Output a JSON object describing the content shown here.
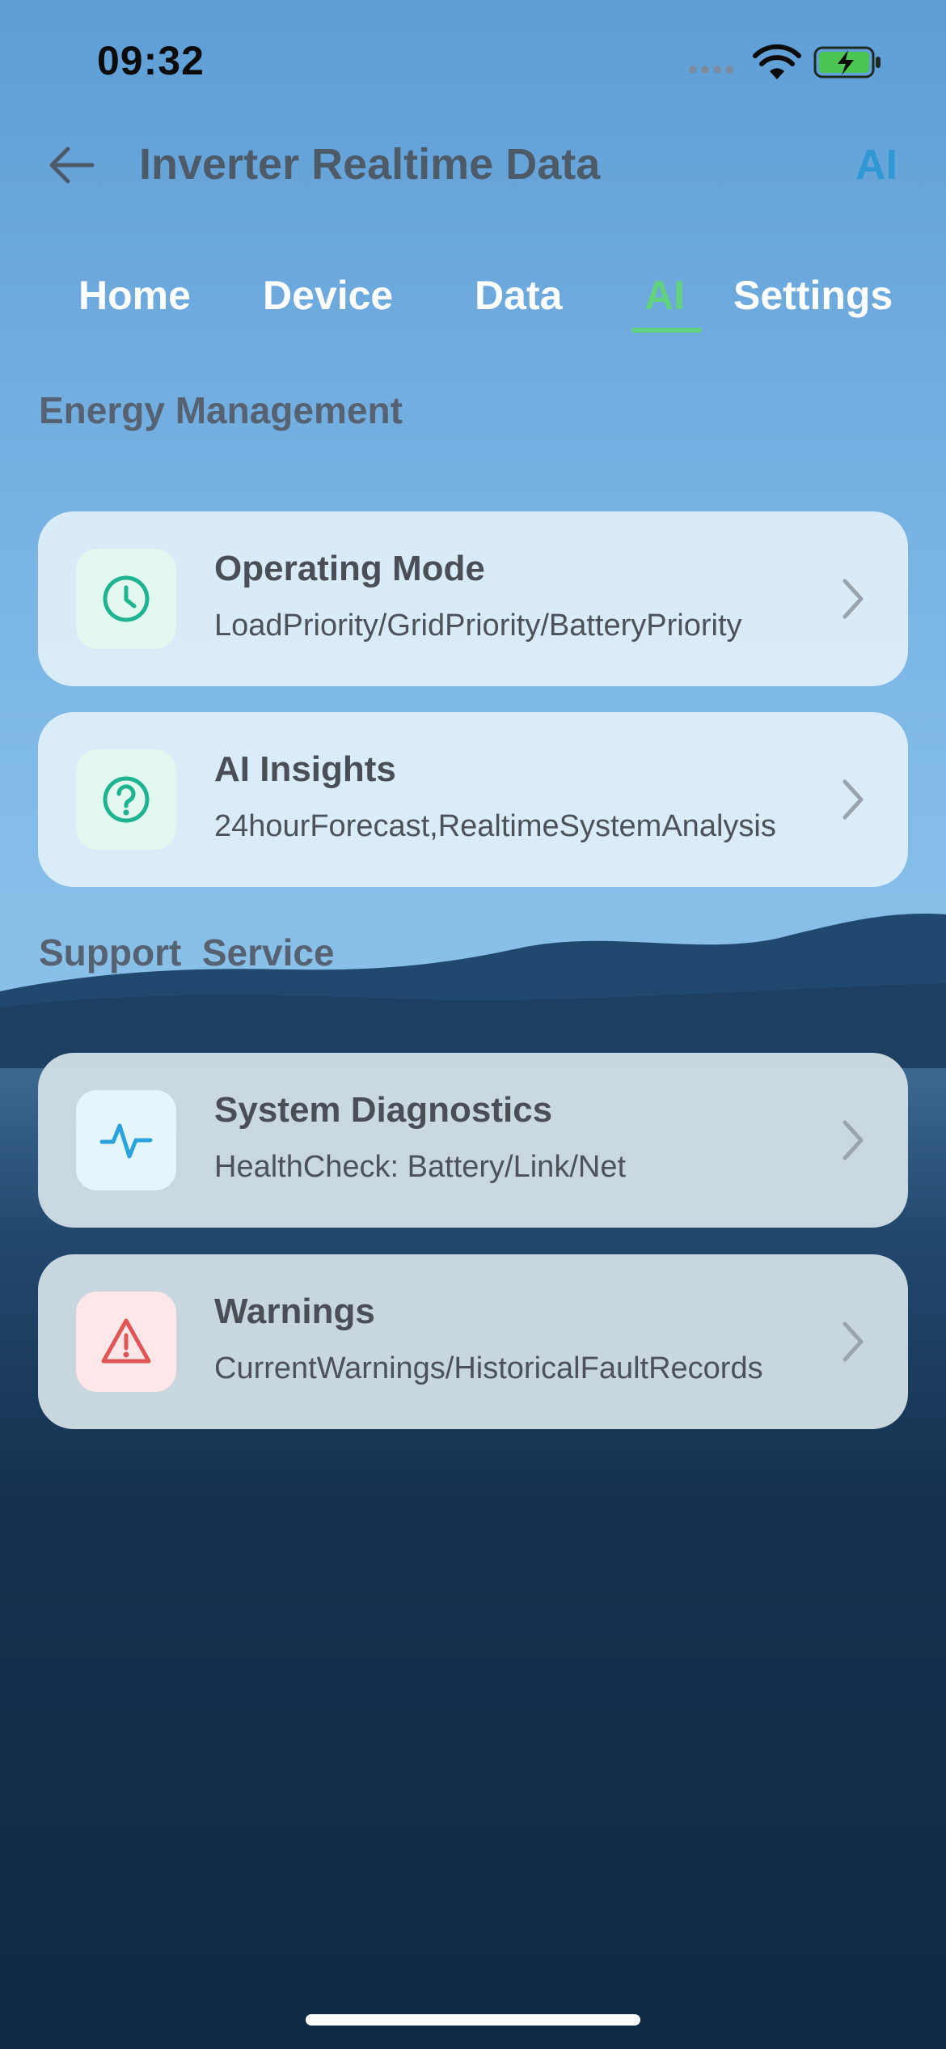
{
  "status_bar": {
    "time": "09:32"
  },
  "header": {
    "title": "Inverter Realtime Data",
    "right_label": "AI"
  },
  "tabs": [
    {
      "label": "Home",
      "active": false
    },
    {
      "label": "Device",
      "active": false
    },
    {
      "label": "Data",
      "active": false
    },
    {
      "label": "AI",
      "active": true
    },
    {
      "label": "Settings",
      "active": false
    }
  ],
  "sections": {
    "energy": {
      "title": "Energy Management",
      "items": [
        {
          "title": "Operating Mode",
          "subtitle": "LoadPriority/GridPriority/BatteryPriority",
          "icon": "clock-icon"
        },
        {
          "title": "AI Insights",
          "subtitle": "24hourForecast,RealtimeSystemAnalysis",
          "icon": "question-icon"
        }
      ]
    },
    "support": {
      "title": "Support  Service",
      "items": [
        {
          "title": "System Diagnostics",
          "subtitle": "HealthCheck: Battery/Link/Net",
          "icon": "pulse-icon"
        },
        {
          "title": "Warnings",
          "subtitle": "CurrentWarnings/HistoricalFaultRecords",
          "icon": "warning-icon"
        }
      ]
    }
  },
  "colors": {
    "accent_green": "#62d27e",
    "accent_blue": "#2f97d2",
    "icon_teal": "#1fb391",
    "icon_blue": "#2aa3dd",
    "icon_red": "#e05656"
  }
}
